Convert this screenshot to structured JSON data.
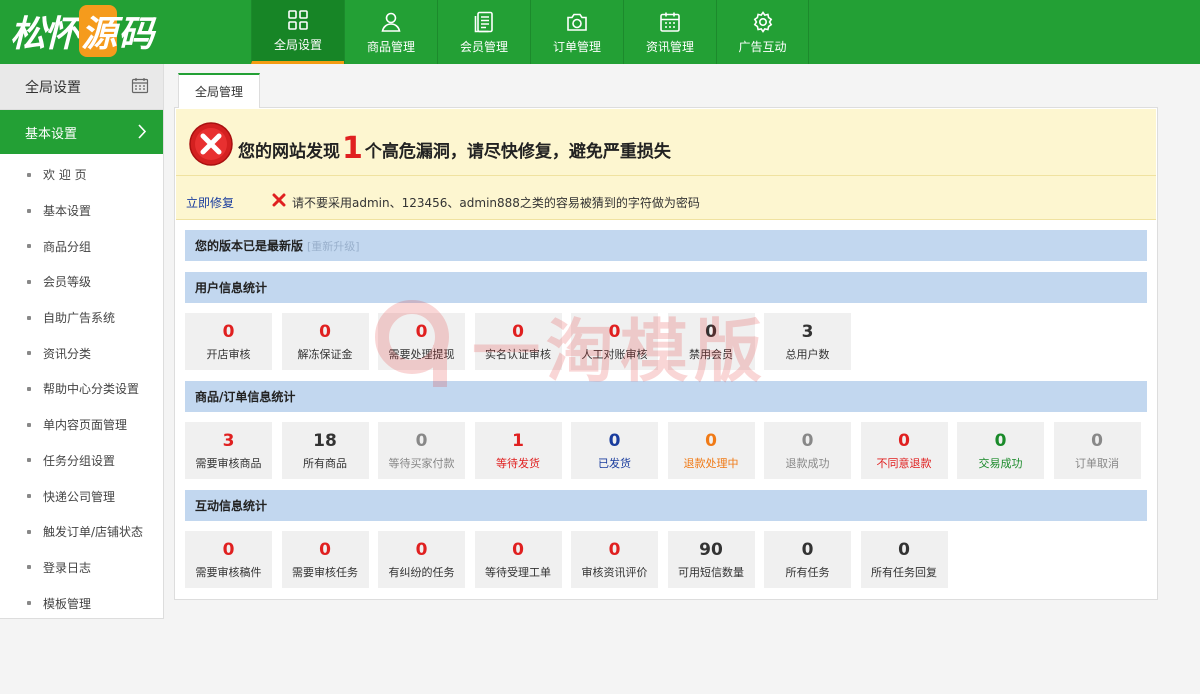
{
  "header": {
    "logo_text_left": "松怀",
    "logo_text_mid": "源",
    "logo_text_right": "码",
    "nav": [
      {
        "label": "全局设置",
        "icon": "grid-icon"
      },
      {
        "label": "商品管理",
        "icon": "user-icon"
      },
      {
        "label": "会员管理",
        "icon": "document-icon"
      },
      {
        "label": "订单管理",
        "icon": "camera-icon"
      },
      {
        "label": "资讯管理",
        "icon": "calendar-icon"
      },
      {
        "label": "广告互动",
        "icon": "gear-icon"
      }
    ]
  },
  "sidebar": {
    "title": "全局设置",
    "active": "基本设置",
    "items": [
      "欢 迎 页",
      "基本设置",
      "商品分组",
      "会员等级",
      "自助广告系统",
      "资讯分类",
      "帮助中心分类设置",
      "单内容页面管理",
      "任务分组设置",
      "快递公司管理",
      "触发订单/店铺状态",
      "登录日志",
      "模板管理"
    ]
  },
  "tab": {
    "label": "全局管理"
  },
  "alert": {
    "title_before": "您的网站发现",
    "count": "1",
    "title_after": "个高危漏洞，请尽快修复，避免严重损失",
    "fix_link": "立即修复",
    "warning": "请不要采用admin、123456、admin888之类的容易被猜到的字符做为密码"
  },
  "version": {
    "text": "您的版本已是最新版",
    "upgrade": "[重新升级]"
  },
  "sections": {
    "user": {
      "title": "用户信息统计",
      "stats": [
        {
          "value": "0",
          "label": "开店审核",
          "color": "red"
        },
        {
          "value": "0",
          "label": "解冻保证金",
          "color": "red"
        },
        {
          "value": "0",
          "label": "需要处理提现",
          "color": "red"
        },
        {
          "value": "0",
          "label": "实名认证审核",
          "color": "red"
        },
        {
          "value": "0",
          "label": "人工对账审核",
          "color": "red"
        },
        {
          "value": "0",
          "label": "禁用会员",
          "color": "dark"
        },
        {
          "value": "3",
          "label": "总用户数",
          "color": "dark"
        }
      ]
    },
    "order": {
      "title": "商品/订单信息统计",
      "stats": [
        {
          "value": "3",
          "label": "需要审核商品",
          "color": "red"
        },
        {
          "value": "18",
          "label": "所有商品",
          "color": "dark"
        },
        {
          "value": "0",
          "label": "等待买家付款",
          "color": "gray"
        },
        {
          "value": "1",
          "label": "等待发货",
          "color": "red"
        },
        {
          "value": "0",
          "label": "已发货",
          "color": "blue"
        },
        {
          "value": "0",
          "label": "退款处理中",
          "color": "orange"
        },
        {
          "value": "0",
          "label": "退款成功",
          "color": "gray"
        },
        {
          "value": "0",
          "label": "不同意退款",
          "color": "red"
        },
        {
          "value": "0",
          "label": "交易成功",
          "color": "green"
        },
        {
          "value": "0",
          "label": "订单取消",
          "color": "gray"
        }
      ]
    },
    "interact": {
      "title": "互动信息统计",
      "stats": [
        {
          "value": "0",
          "label": "需要审核稿件",
          "color": "red"
        },
        {
          "value": "0",
          "label": "需要审核任务",
          "color": "red"
        },
        {
          "value": "0",
          "label": "有纠纷的任务",
          "color": "red"
        },
        {
          "value": "0",
          "label": "等待受理工单",
          "color": "red"
        },
        {
          "value": "0",
          "label": "审核资讯评价",
          "color": "red"
        },
        {
          "value": "90",
          "label": "可用短信数量",
          "color": "dark"
        },
        {
          "value": "0",
          "label": "所有任务",
          "color": "dark"
        },
        {
          "value": "0",
          "label": "所有任务回复",
          "color": "dark"
        }
      ]
    }
  },
  "watermark": {
    "text": "一淘模版"
  },
  "colors": {
    "brand_green": "#23a035",
    "nav_active": "#178526",
    "accent_orange": "#f39c12",
    "alert_bg": "#fdf6d0",
    "bar_blue": "#c2d7ef",
    "danger_red": "#e02020"
  }
}
